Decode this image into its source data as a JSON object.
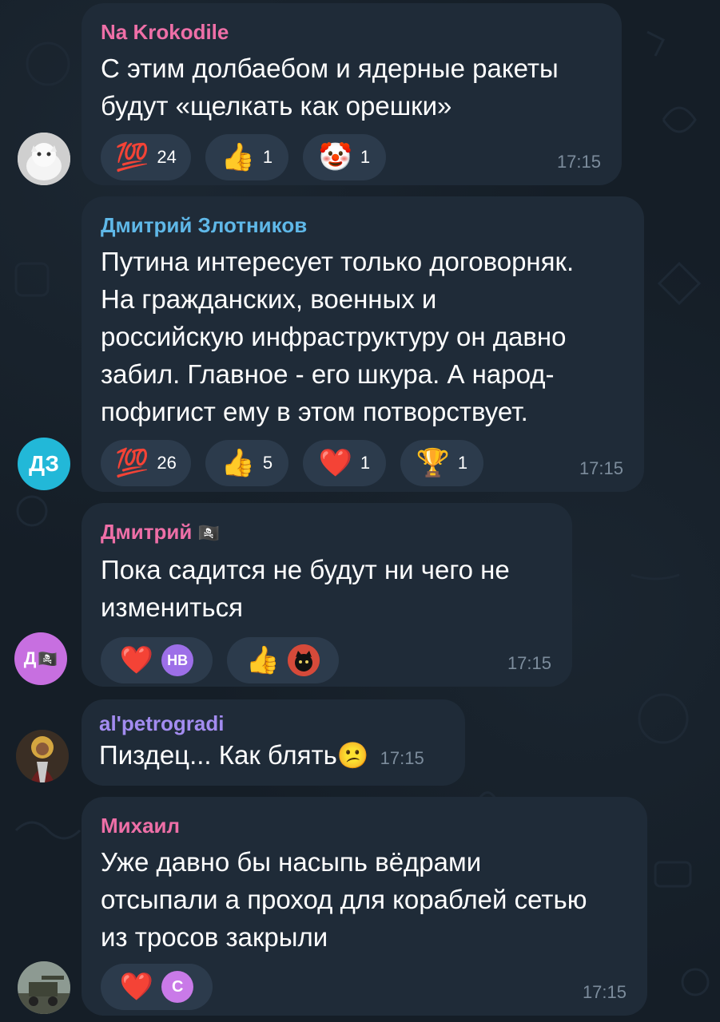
{
  "messages": [
    {
      "sender": "Na Krokodile",
      "sender_color": "#ee6fa7",
      "text": "С этим долбаебом и ядерные ракеты\nбудут «щелкать как орешки»",
      "time": "17:15",
      "reactions": [
        {
          "emoji": "💯",
          "count": "24"
        },
        {
          "emoji": "👍",
          "count": "1"
        },
        {
          "emoji": "🤡",
          "count": "1"
        }
      ],
      "avatar": {
        "icon": "cat-photo-avatar"
      }
    },
    {
      "sender": "Дмитрий Злотников",
      "sender_color": "#5fb8e8",
      "text": "Путина интересует только договорняк.\nНа гражданских, военных и\nроссийскую инфраструктуру он давно\nзабил. Главное - его шкура. А народ-\nпофигист ему в этом потворствует.",
      "time": "17:15",
      "reactions": [
        {
          "emoji": "💯",
          "count": "26"
        },
        {
          "emoji": "👍",
          "count": "5"
        },
        {
          "emoji": "❤️",
          "count": "1"
        },
        {
          "emoji": "🏆",
          "count": "1"
        }
      ],
      "avatar": {
        "initials": "ДЗ",
        "color": "#22b8d8"
      }
    },
    {
      "sender": "Дмитрий",
      "sender_flag": "🏴‍☠️",
      "sender_color": "#ee6fa7",
      "text": "Пока садится не будут ни чего не\nизмениться",
      "time": "17:15",
      "reactions": [
        {
          "emoji": "❤️",
          "reactor_initials": "НВ",
          "reactor_color": "#9d6fe8"
        },
        {
          "emoji": "👍",
          "reactor_icon": "black-cat-avatar"
        }
      ],
      "avatar": {
        "initials": "Д",
        "flag": "🏴‍☠️",
        "color": "#c76fe0"
      }
    },
    {
      "sender": "al'petrogradi",
      "sender_color": "#a38cf0",
      "text": "Пиздец... Как блять",
      "text_emoji": "😕",
      "time": "17:15",
      "avatar": {
        "icon": "icon-portrait-avatar"
      }
    },
    {
      "sender": "Михаил",
      "sender_color": "#ee6fa7",
      "text": "Уже давно бы насыпь вёдрами\nотсыпали а проход для кораблей сетью\nиз тросов закрыли",
      "time": "17:15",
      "reactions": [
        {
          "emoji": "❤️",
          "reactor_initials": "С",
          "reactor_color": "#c97ae8"
        }
      ],
      "avatar": {
        "icon": "military-vehicle-avatar"
      }
    }
  ]
}
